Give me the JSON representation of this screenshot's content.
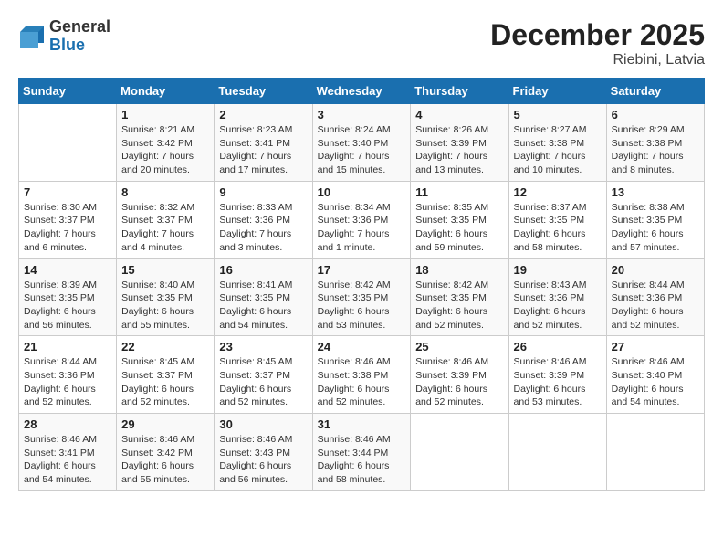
{
  "logo": {
    "line1": "General",
    "line2": "Blue"
  },
  "title": "December 2025",
  "subtitle": "Riebini, Latvia",
  "days_of_week": [
    "Sunday",
    "Monday",
    "Tuesday",
    "Wednesday",
    "Thursday",
    "Friday",
    "Saturday"
  ],
  "weeks": [
    [
      {
        "day": "",
        "info": ""
      },
      {
        "day": "1",
        "info": "Sunrise: 8:21 AM\nSunset: 3:42 PM\nDaylight: 7 hours\nand 20 minutes."
      },
      {
        "day": "2",
        "info": "Sunrise: 8:23 AM\nSunset: 3:41 PM\nDaylight: 7 hours\nand 17 minutes."
      },
      {
        "day": "3",
        "info": "Sunrise: 8:24 AM\nSunset: 3:40 PM\nDaylight: 7 hours\nand 15 minutes."
      },
      {
        "day": "4",
        "info": "Sunrise: 8:26 AM\nSunset: 3:39 PM\nDaylight: 7 hours\nand 13 minutes."
      },
      {
        "day": "5",
        "info": "Sunrise: 8:27 AM\nSunset: 3:38 PM\nDaylight: 7 hours\nand 10 minutes."
      },
      {
        "day": "6",
        "info": "Sunrise: 8:29 AM\nSunset: 3:38 PM\nDaylight: 7 hours\nand 8 minutes."
      }
    ],
    [
      {
        "day": "7",
        "info": "Sunrise: 8:30 AM\nSunset: 3:37 PM\nDaylight: 7 hours\nand 6 minutes."
      },
      {
        "day": "8",
        "info": "Sunrise: 8:32 AM\nSunset: 3:37 PM\nDaylight: 7 hours\nand 4 minutes."
      },
      {
        "day": "9",
        "info": "Sunrise: 8:33 AM\nSunset: 3:36 PM\nDaylight: 7 hours\nand 3 minutes."
      },
      {
        "day": "10",
        "info": "Sunrise: 8:34 AM\nSunset: 3:36 PM\nDaylight: 7 hours\nand 1 minute."
      },
      {
        "day": "11",
        "info": "Sunrise: 8:35 AM\nSunset: 3:35 PM\nDaylight: 6 hours\nand 59 minutes."
      },
      {
        "day": "12",
        "info": "Sunrise: 8:37 AM\nSunset: 3:35 PM\nDaylight: 6 hours\nand 58 minutes."
      },
      {
        "day": "13",
        "info": "Sunrise: 8:38 AM\nSunset: 3:35 PM\nDaylight: 6 hours\nand 57 minutes."
      }
    ],
    [
      {
        "day": "14",
        "info": "Sunrise: 8:39 AM\nSunset: 3:35 PM\nDaylight: 6 hours\nand 56 minutes."
      },
      {
        "day": "15",
        "info": "Sunrise: 8:40 AM\nSunset: 3:35 PM\nDaylight: 6 hours\nand 55 minutes."
      },
      {
        "day": "16",
        "info": "Sunrise: 8:41 AM\nSunset: 3:35 PM\nDaylight: 6 hours\nand 54 minutes."
      },
      {
        "day": "17",
        "info": "Sunrise: 8:42 AM\nSunset: 3:35 PM\nDaylight: 6 hours\nand 53 minutes."
      },
      {
        "day": "18",
        "info": "Sunrise: 8:42 AM\nSunset: 3:35 PM\nDaylight: 6 hours\nand 52 minutes."
      },
      {
        "day": "19",
        "info": "Sunrise: 8:43 AM\nSunset: 3:36 PM\nDaylight: 6 hours\nand 52 minutes."
      },
      {
        "day": "20",
        "info": "Sunrise: 8:44 AM\nSunset: 3:36 PM\nDaylight: 6 hours\nand 52 minutes."
      }
    ],
    [
      {
        "day": "21",
        "info": "Sunrise: 8:44 AM\nSunset: 3:36 PM\nDaylight: 6 hours\nand 52 minutes."
      },
      {
        "day": "22",
        "info": "Sunrise: 8:45 AM\nSunset: 3:37 PM\nDaylight: 6 hours\nand 52 minutes."
      },
      {
        "day": "23",
        "info": "Sunrise: 8:45 AM\nSunset: 3:37 PM\nDaylight: 6 hours\nand 52 minutes."
      },
      {
        "day": "24",
        "info": "Sunrise: 8:46 AM\nSunset: 3:38 PM\nDaylight: 6 hours\nand 52 minutes."
      },
      {
        "day": "25",
        "info": "Sunrise: 8:46 AM\nSunset: 3:39 PM\nDaylight: 6 hours\nand 52 minutes."
      },
      {
        "day": "26",
        "info": "Sunrise: 8:46 AM\nSunset: 3:39 PM\nDaylight: 6 hours\nand 53 minutes."
      },
      {
        "day": "27",
        "info": "Sunrise: 8:46 AM\nSunset: 3:40 PM\nDaylight: 6 hours\nand 54 minutes."
      }
    ],
    [
      {
        "day": "28",
        "info": "Sunrise: 8:46 AM\nSunset: 3:41 PM\nDaylight: 6 hours\nand 54 minutes."
      },
      {
        "day": "29",
        "info": "Sunrise: 8:46 AM\nSunset: 3:42 PM\nDaylight: 6 hours\nand 55 minutes."
      },
      {
        "day": "30",
        "info": "Sunrise: 8:46 AM\nSunset: 3:43 PM\nDaylight: 6 hours\nand 56 minutes."
      },
      {
        "day": "31",
        "info": "Sunrise: 8:46 AM\nSunset: 3:44 PM\nDaylight: 6 hours\nand 58 minutes."
      },
      {
        "day": "",
        "info": ""
      },
      {
        "day": "",
        "info": ""
      },
      {
        "day": "",
        "info": ""
      }
    ]
  ]
}
